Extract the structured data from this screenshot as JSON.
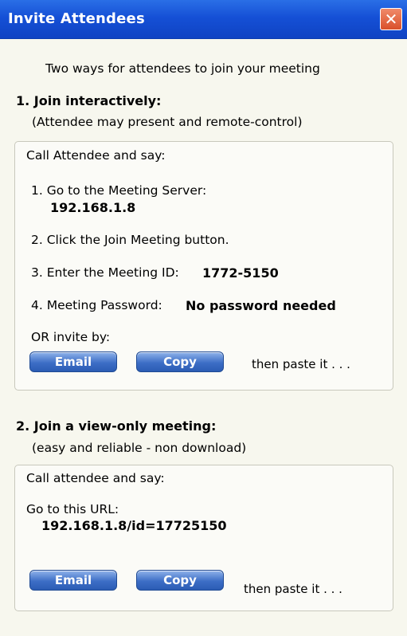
{
  "window": {
    "title": "Invite Attendees",
    "close_label": "✕"
  },
  "subtitle": "Two ways for attendees to join your meeting",
  "section1": {
    "heading": "1. Join interactively:",
    "note": "(Attendee may present and remote-control)",
    "call_label": "Call Attendee and say:",
    "step1": "1. Go to the Meeting Server:",
    "server": "192.168.1.8",
    "step2": "2. Click the Join Meeting button.",
    "step3_label": "3. Enter the Meeting ID:",
    "meeting_id": "1772-5150",
    "step4_label": "4. Meeting Password:",
    "password": "No password needed",
    "or_invite": "OR invite by:",
    "email_button": "Email",
    "copy_button": "Copy",
    "paste_text": "then paste it . . ."
  },
  "section2": {
    "heading": "2. Join a view-only meeting:",
    "note": "(easy and reliable - non download)",
    "call_label": "Call attendee and say:",
    "url_label": "Go to this URL:",
    "url": "192.168.1.8/id=17725150",
    "email_button": "Email",
    "copy_button": "Copy",
    "paste_text": "then paste it . . ."
  }
}
